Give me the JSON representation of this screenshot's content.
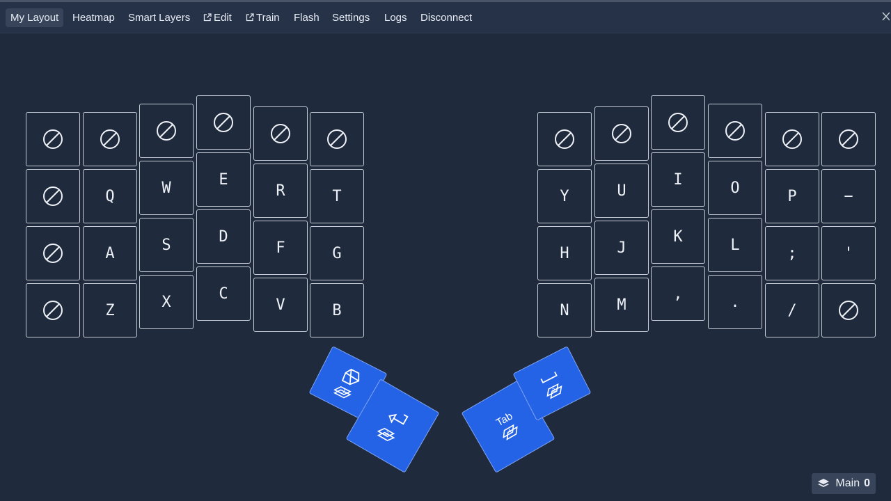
{
  "nav": {
    "items": [
      {
        "label": "My Layout",
        "active": true
      },
      {
        "label": "Heatmap"
      },
      {
        "label": "Smart Layers"
      },
      {
        "label": "Edit",
        "external": true
      },
      {
        "label": "Train",
        "external": true
      },
      {
        "label": "Flash"
      },
      {
        "label": "Settings"
      },
      {
        "label": "Logs"
      },
      {
        "label": "Disconnect"
      }
    ]
  },
  "keys": {
    "left": {
      "row0": [
        "none-icon",
        "none-icon",
        "none-icon",
        "none-icon",
        "none-icon",
        "none-icon"
      ],
      "row1": [
        "none-icon",
        "Q",
        "W",
        "E",
        "R",
        "T"
      ],
      "row2": [
        "none-icon",
        "A",
        "S",
        "D",
        "F",
        "G"
      ],
      "row3": [
        "none-icon",
        "Z",
        "X",
        "C",
        "V",
        "B"
      ]
    },
    "right": {
      "row0": [
        "none-icon",
        "none-icon",
        "none-icon",
        "none-icon",
        "none-icon",
        "none-icon"
      ],
      "row1": [
        "Y",
        "U",
        "I",
        "O",
        "P",
        "−"
      ],
      "row2": [
        "H",
        "J",
        "K",
        "L",
        ";",
        "'"
      ],
      "row3": [
        "N",
        "M",
        ",",
        ".",
        "/",
        "none-icon"
      ]
    }
  },
  "thumbs": {
    "left_outer": {
      "icon": "escape-icon",
      "layer": "1"
    },
    "left_inner": {
      "icon": "return-icon",
      "layer": "3"
    },
    "right_inner": {
      "label": "Tab",
      "layer": "4"
    },
    "right_outer": {
      "icon": "space-icon",
      "layer": "2"
    }
  },
  "layer_indicator": {
    "label": "Main",
    "number": "0"
  },
  "colors": {
    "background": "#1f2a3d",
    "navbar": "#263247",
    "thumb_key": "#2463e6",
    "key_border": "#c7cdd6"
  }
}
